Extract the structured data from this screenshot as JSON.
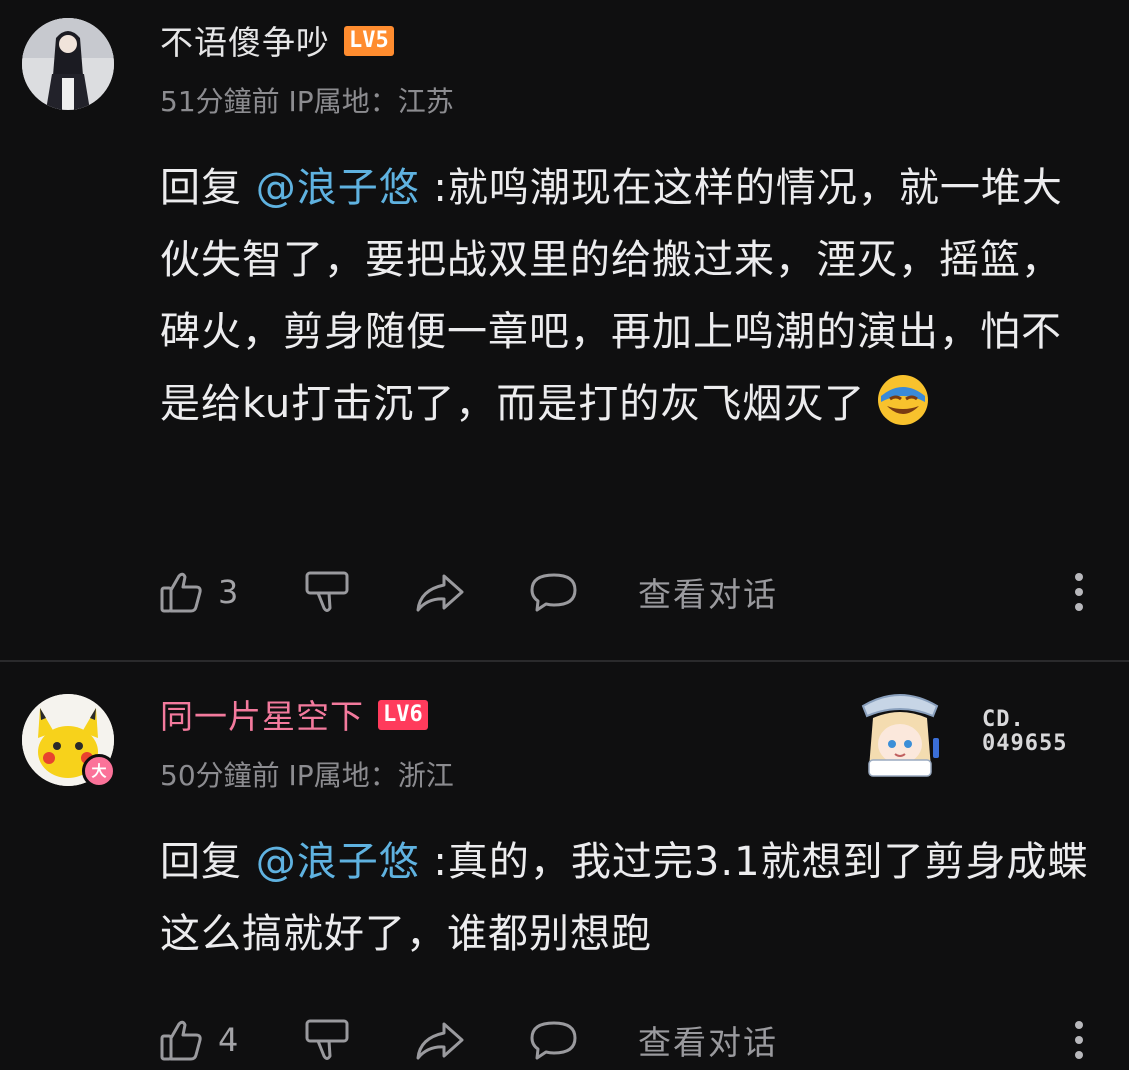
{
  "comments": [
    {
      "username": "不语傻争吵",
      "level": "LV5",
      "time": "51分鐘前",
      "ip": "IP属地：江苏",
      "reply_prefix": "回复",
      "mention": "@浪子悠",
      "text": " :就鸣潮现在这样的情况，就一堆大伙失智了，要把战双里的给搬过来，湮灭，摇篮，碑火，剪身随便一章吧，再加上鸣潮的演出，怕不是给ku打击沉了，而是打的灰飞烟灭了",
      "emoji": "laughing-crying-emoji",
      "likes": "3",
      "view_conversation": "查看对话"
    },
    {
      "username": "同一片星空下",
      "level": "LV6",
      "badge": "大",
      "time": "50分鐘前",
      "ip": "IP属地：浙江",
      "decoration_number": "CD.\n049655",
      "reply_prefix": "回复",
      "mention": "@浪子悠",
      "text": " :真的，我过完3.1就想到了剪身成蝶这么搞就好了，谁都别想跑",
      "likes": "4",
      "view_conversation": "查看对话"
    }
  ],
  "colors": {
    "background": "#0f0f10",
    "mention": "#5fb2e0",
    "vip_name": "#f37a9d",
    "lv5": "#ff8c2f",
    "lv6": "#ff3b5c"
  }
}
